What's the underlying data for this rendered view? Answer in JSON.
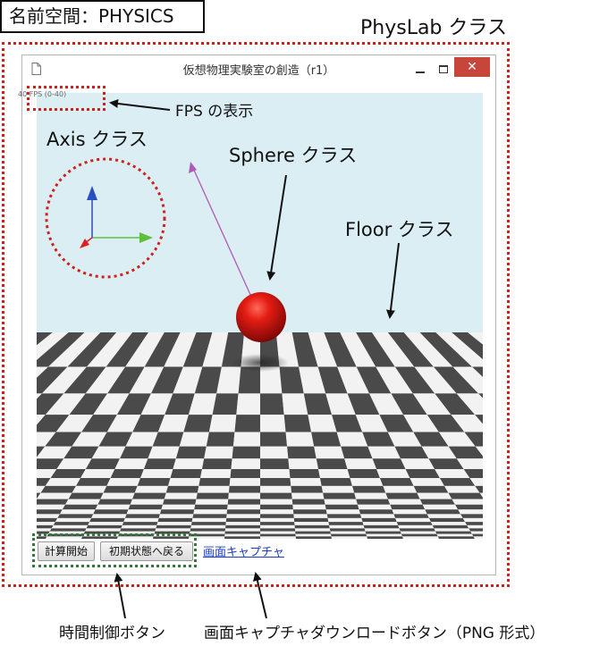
{
  "namespace_label": "名前空間：PHYSICS",
  "physlab_label": "PhysLab クラス",
  "window": {
    "title": "仮想物理実験室の創造（r1）",
    "close_glyph": "✕"
  },
  "fps_text": "40 FPS (0-40)",
  "controls": {
    "start_button": "計算開始",
    "reset_button": "初期状態へ戻る",
    "capture_link": "画面キャプチャ"
  },
  "annotations": {
    "fps": "FPS の表示",
    "axis": "Axis クラス",
    "sphere": "Sphere クラス",
    "floor": "Floor クラス",
    "time_control": "時間制御ボタン",
    "capture_download": "画面キャプチャダウンロードボタン（PNG 形式）"
  },
  "colors": {
    "annotation_red": "#d0201a",
    "annotation_green": "#2f7a3a",
    "sky": "#dbeef3",
    "floor_dark": "#4a4a4a",
    "floor_light": "#f2f2f2",
    "sphere": "#d81414",
    "axis_x": "#5fbf3a",
    "axis_y": "#2a4fc0",
    "axis_z": "#e02020",
    "velocity_vector": "#b05ab8"
  }
}
